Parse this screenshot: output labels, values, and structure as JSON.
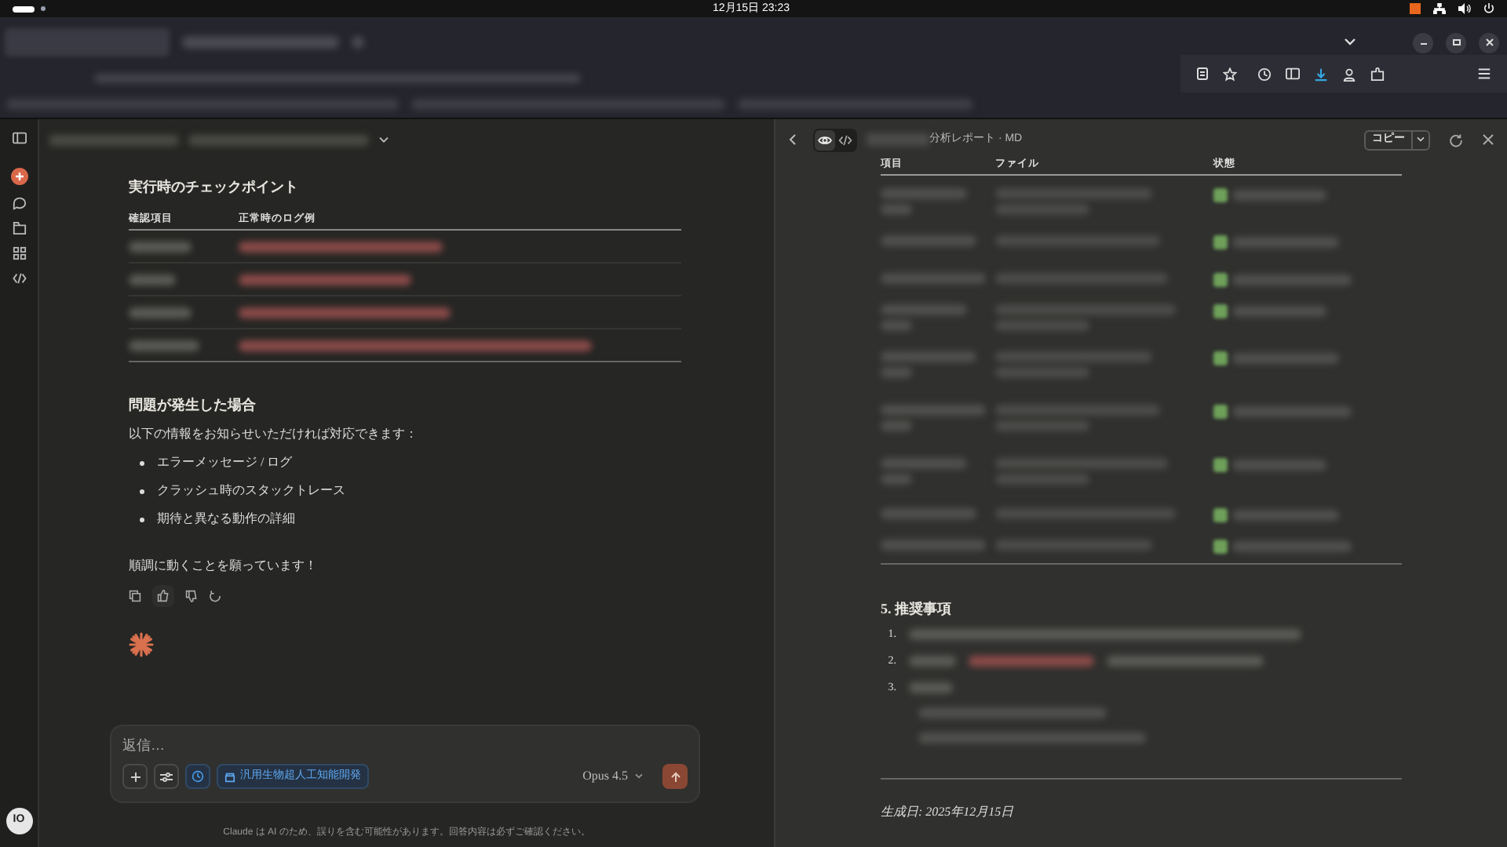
{
  "top_bar": {
    "clock": "12月15日 23:23"
  },
  "chat": {
    "blocks": [
      {
        "kind": "heading",
        "text": "実行時のチェックポイント"
      },
      {
        "kind": "table",
        "columns": [
          "確認項目",
          "正常時のログ例"
        ]
      },
      {
        "kind": "heading",
        "text": "問題が発生した場合"
      },
      {
        "kind": "paragraph",
        "text": "以下の情報をお知らせいただければ対応できます："
      },
      {
        "kind": "bullets",
        "items": [
          "エラーメッセージ / ログ",
          "クラッシュ時のスタックトレース",
          "期待と異なる動作の詳細"
        ]
      },
      {
        "kind": "paragraph",
        "text": "順調に動くことを願っています！"
      }
    ]
  },
  "composer": {
    "placeholder": "返信…",
    "project": "汎用生物超人工知能開発",
    "model": "Opus 4.5"
  },
  "disclaimer": "Claude は AI のため、誤りを含む可能性があります。回答内容は必ずご確認ください。",
  "user_avatar": "IO",
  "artifact": {
    "subtitle": "分析レポート · MD",
    "view_modes": [
      {
        "kind": "preview",
        "selected": true
      },
      {
        "kind": "code",
        "selected": false
      }
    ],
    "copy_label": "コピー",
    "table": {
      "columns": [
        "項目",
        "ファイル",
        "状態"
      ]
    },
    "section_heading": "5. 推奨事項",
    "list_numbers": [
      "1.",
      "2.",
      "3."
    ],
    "footer": "生成日: 2025年12月15日"
  }
}
